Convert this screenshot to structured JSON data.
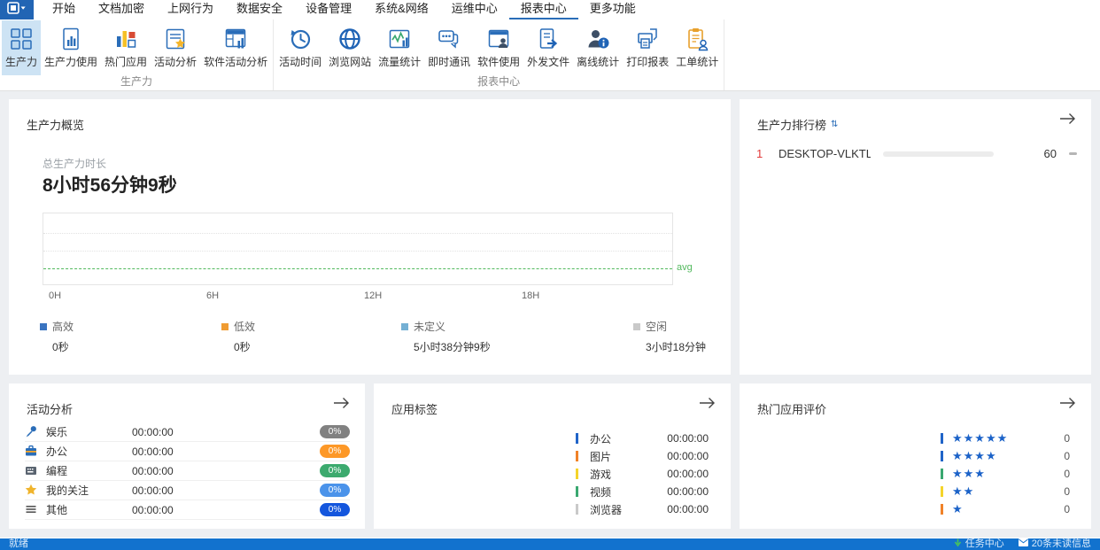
{
  "menubar": {
    "tabs": [
      "开始",
      "文档加密",
      "上网行为",
      "数据安全",
      "设备管理",
      "系统&网络",
      "运维中心",
      "报表中心",
      "更多功能"
    ],
    "active_tab": "报表中心"
  },
  "ribbon": {
    "groups": [
      {
        "label": "生产力",
        "buttons": [
          "生产力",
          "生产力使用",
          "热门应用",
          "活动分析",
          "软件活动分析"
        ]
      },
      {
        "label": "报表中心",
        "buttons": [
          "活动时间",
          "浏览网站",
          "流量统计",
          "即时通讯",
          "软件使用",
          "外发文件",
          "离线统计",
          "打印报表",
          "工单统计"
        ]
      }
    ]
  },
  "chart_data": {
    "type": "line",
    "title": "生产力概览",
    "x_ticks": [
      "0H",
      "6H",
      "12H",
      "18H"
    ],
    "x_range_hours": [
      0,
      24
    ],
    "series": [],
    "avg_line": {
      "label": "avg",
      "color": "#53b95e"
    },
    "grid": "dotted-horizontal",
    "legend_position": "bottom",
    "legend": [
      {
        "label": "高效",
        "value": "0秒",
        "color": "#3a74c0"
      },
      {
        "label": "低效",
        "value": "0秒",
        "color": "#f09c32"
      },
      {
        "label": "未定义",
        "value": "5小时38分钟9秒",
        "color": "#74b0d4"
      },
      {
        "label": "空闲",
        "value": "3小时18分钟",
        "color": "#c9c9c9"
      }
    ]
  },
  "overview": {
    "title": "生产力概览",
    "total_label": "总生产力时长",
    "total_value": "8小时56分钟9秒"
  },
  "ranking": {
    "title": "生产力排行榜",
    "rows": [
      {
        "rank": "1",
        "name": "DESKTOP-VLKTL...",
        "score": "60",
        "bar_width": "60%"
      }
    ]
  },
  "activity": {
    "title": "活动分析",
    "rows": [
      {
        "label": "娱乐",
        "time": "00:00:00",
        "percent": "0%",
        "pill_color": "#818181"
      },
      {
        "label": "办公",
        "time": "00:00:00",
        "percent": "0%",
        "pill_color": "#fd9827"
      },
      {
        "label": "编程",
        "time": "00:00:00",
        "percent": "0%",
        "pill_color": "#3caa6e"
      },
      {
        "label": "我的关注",
        "time": "00:00:00",
        "percent": "0%",
        "pill_color": "#4b93ea"
      },
      {
        "label": "其他",
        "time": "00:00:00",
        "percent": "0%",
        "pill_color": "#1456dd"
      }
    ]
  },
  "app_tags": {
    "title": "应用标签",
    "rows": [
      {
        "label": "办公",
        "time": "00:00:00",
        "color": "#2064c8"
      },
      {
        "label": "图片",
        "time": "00:00:00",
        "color": "#f08228"
      },
      {
        "label": "游戏",
        "time": "00:00:00",
        "color": "#f5d42a"
      },
      {
        "label": "视频",
        "time": "00:00:00",
        "color": "#3aa870"
      },
      {
        "label": "浏览器",
        "time": "00:00:00",
        "color": "#c9c9c9"
      }
    ]
  },
  "app_ratings": {
    "title": "热门应用评价",
    "star_color": "#1b62c8",
    "rows": [
      {
        "stars": "★★★★★",
        "count": "0",
        "color": "#2064c8"
      },
      {
        "stars": "★★★★",
        "count": "0",
        "color": "#2064c8"
      },
      {
        "stars": "★★★",
        "count": "0",
        "color": "#3aa870"
      },
      {
        "stars": "★★",
        "count": "0",
        "color": "#f5d42a"
      },
      {
        "stars": "★",
        "count": "0",
        "color": "#f08228"
      }
    ]
  },
  "statusbar": {
    "ready": "就绪",
    "task_center": "任务中心",
    "unread": "20条未读信息"
  }
}
